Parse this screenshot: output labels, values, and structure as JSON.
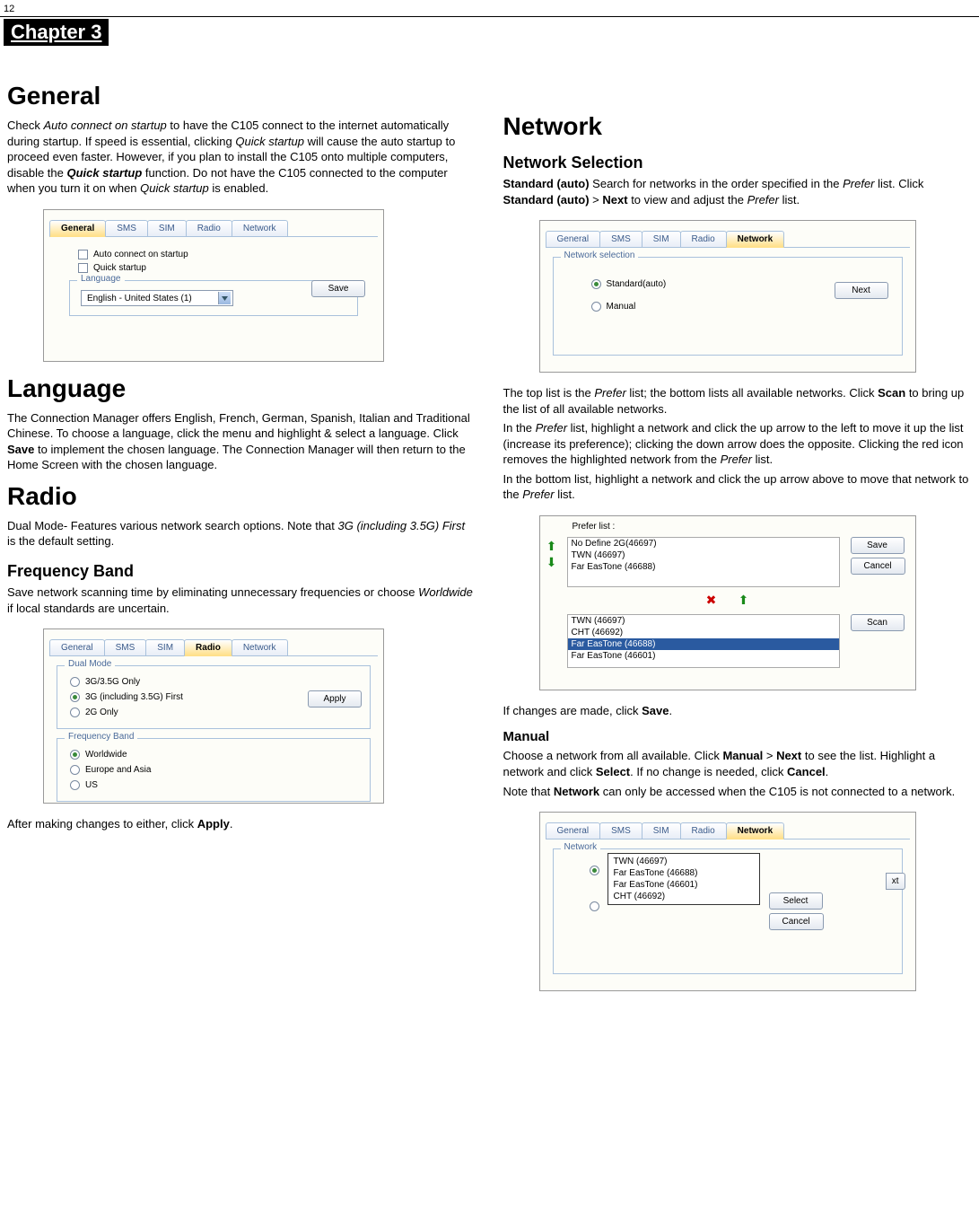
{
  "page_number": "12",
  "chapter": "Chapter 3",
  "tabs": [
    "General",
    "SMS",
    "SIM",
    "Radio",
    "Network"
  ],
  "col1": {
    "general_h": "General",
    "general_p": "Check Auto connect on startup to have the C105 connect to the internet automatically during startup. If speed is essential, clicking Quick startup will cause the auto startup to proceed even faster. However, if you plan to install the C105 onto multiple computers, disable the Quick startup function. Do not have the C105 connected to the computer when you turn it on when Quick startup is enabled.",
    "ss1": {
      "cb1": "Auto connect on startup",
      "cb2": "Quick startup",
      "legend": "Language",
      "dd": "English - United States (1)",
      "btn": "Save"
    },
    "language_h": "Language",
    "language_p": "The Connection Manager offers English, French, German, Spanish, Italian and Traditional Chinese. To choose a language, click the menu and highlight & select a language. Click Save to implement the chosen language. The Connection Manager will then return to the Home Screen with the chosen language.",
    "radio_h": "Radio",
    "radio_p": "Dual Mode- Features various network search options. Note that 3G (including 3.5G) First is the default setting.",
    "freq_h": "Frequency Band",
    "freq_p": "Save network scanning time by eliminating unnecessary frequencies or choose Worldwide if local standards are uncertain.",
    "ss2": {
      "legend1": "Dual Mode",
      "r1": "3G/3.5G Only",
      "r2": "3G (including 3.5G) First",
      "r3": "2G Only",
      "legend2": "Frequency Band",
      "r4": "Worldwide",
      "r5": "Europe and Asia",
      "r6": "US",
      "btn": "Apply"
    },
    "after_apply": "After making changes to either, click Apply."
  },
  "col2": {
    "network_h": "Network",
    "netsel_h": "Network Selection",
    "netsel_p": "Standard (auto) Search for networks in the order specified in the Prefer list. Click Standard (auto) > Next to view and adjust the Prefer list.",
    "ss3": {
      "legend": "Network selection",
      "r1": "Standard(auto)",
      "r2": "Manual",
      "btn": "Next"
    },
    "top_p": "The top list is the Prefer list; the bottom lists all available networks. Click Scan to bring up the list of all available networks.",
    "prefer_p": "In the Prefer list, highlight a network and click the up arrow to the left to move it up the list (increase its preference); clicking the down arrow does the opposite. Clicking the red icon removes the highlighted network from the Prefer list.",
    "bottom_p": "In the bottom list, highlight a network and click the up arrow above to move that network to the Prefer list.",
    "ss4": {
      "prefer_label": "Prefer list :",
      "top": [
        "No Define 2G(46697)",
        "TWN (46697)",
        "Far EasTone (46688)"
      ],
      "bottom": [
        "TWN (46697)",
        "CHT (46692)",
        "Far EasTone (46688)",
        "Far EasTone (46601)"
      ],
      "btn_save": "Save",
      "btn_cancel": "Cancel",
      "btn_scan": "Scan"
    },
    "save_p": "If changes are made, click Save.",
    "manual_h": "Manual",
    "manual_p": "Choose a network from all available. Click Manual > Next to see the list. Highlight a network and click Select. If no change is needed, click Cancel.",
    "note_p": "Note that Network can only be accessed when the C105 is not connected to a network.",
    "ss5": {
      "legend": "Network",
      "list": [
        "TWN (46697)",
        "Far EasTone (46688)",
        "Far EasTone (46601)",
        "CHT (46692)"
      ],
      "btn_select": "Select",
      "btn_cancel": "Cancel",
      "btn_next_partial": "xt"
    }
  }
}
